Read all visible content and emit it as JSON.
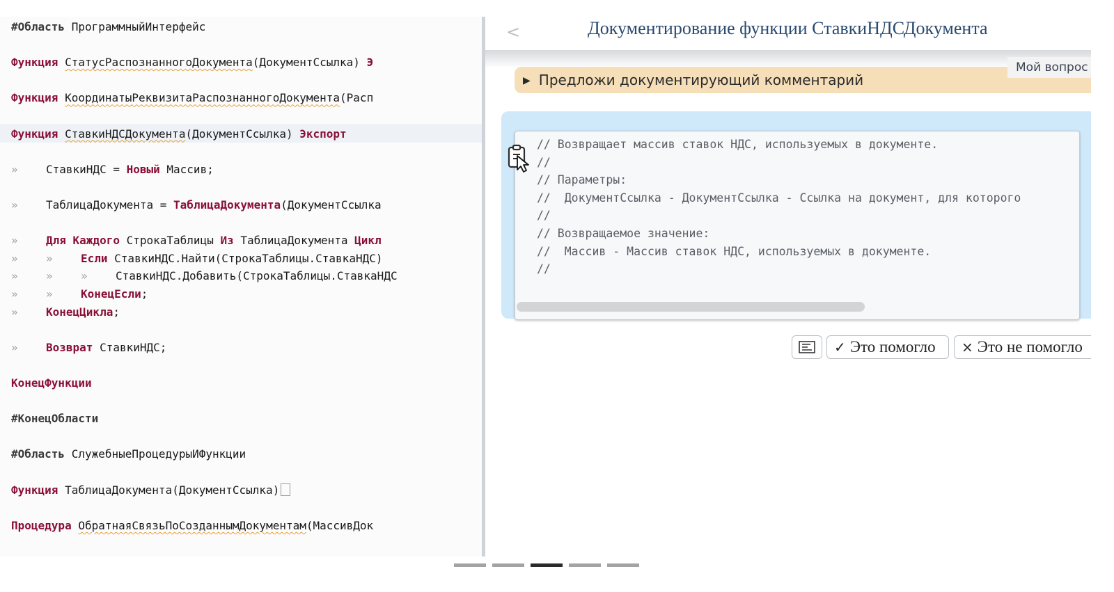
{
  "editor": {
    "lines": [
      [
        {
          "t": "#Область",
          "c": "dir"
        },
        {
          "t": " ПрограммныйИнтерфейс",
          "c": "id"
        }
      ],
      [],
      [
        {
          "t": "Функция",
          "c": "kw"
        },
        {
          "t": " ",
          "c": "id"
        },
        {
          "t": "СтатусРаспознанногоДокумента",
          "c": "id wavy"
        },
        {
          "t": "(ДокументСсылка) ",
          "c": "id"
        },
        {
          "t": "Э",
          "c": "kw"
        }
      ],
      [],
      [
        {
          "t": "Функция",
          "c": "kw"
        },
        {
          "t": " ",
          "c": "id"
        },
        {
          "t": "КоординатыРеквизитаРаспознанногоДокумента",
          "c": "id wavy"
        },
        {
          "t": "(Расп",
          "c": "id"
        }
      ],
      [],
      [
        {
          "t": "Функция",
          "c": "kw"
        },
        {
          "t": " ",
          "c": "id"
        },
        {
          "t": "СтавкиНДСДокумента",
          "c": "id wavy"
        },
        {
          "t": "(ДокументСсылка) ",
          "c": "id"
        },
        {
          "t": "Экспорт",
          "c": "kw"
        }
      ],
      [],
      [
        {
          "i": 1
        },
        {
          "t": "СтавкиНДС = ",
          "c": "id"
        },
        {
          "t": "Новый",
          "c": "kw"
        },
        {
          "t": " Массив;",
          "c": "id"
        }
      ],
      [],
      [
        {
          "i": 1
        },
        {
          "t": "ТаблицаДокумента = ",
          "c": "id"
        },
        {
          "t": "ТаблицаДокумента",
          "c": "kw"
        },
        {
          "t": "(ДокументСсылка",
          "c": "id"
        }
      ],
      [],
      [
        {
          "i": 1
        },
        {
          "t": "Для Каждого",
          "c": "kw"
        },
        {
          "t": " СтрокаТаблицы ",
          "c": "id"
        },
        {
          "t": "Из",
          "c": "kw"
        },
        {
          "t": " ТаблицаДокумента ",
          "c": "id"
        },
        {
          "t": "Цикл",
          "c": "kw"
        }
      ],
      [
        {
          "i": 2
        },
        {
          "t": "Если",
          "c": "kw"
        },
        {
          "t": " СтавкиНДС.Найти(СтрокаТаблицы.СтавкаНДС) ",
          "c": "id"
        }
      ],
      [
        {
          "i": 3
        },
        {
          "t": "СтавкиНДС.Добавить(СтрокаТаблицы.СтавкаНДС",
          "c": "id"
        }
      ],
      [
        {
          "i": 2
        },
        {
          "t": "КонецЕсли",
          "c": "kw"
        },
        {
          "t": ";",
          "c": "id"
        }
      ],
      [
        {
          "i": 1
        },
        {
          "t": "КонецЦикла",
          "c": "kw"
        },
        {
          "t": ";",
          "c": "id"
        }
      ],
      [],
      [
        {
          "i": 1
        },
        {
          "t": "Возврат",
          "c": "kw"
        },
        {
          "t": " СтавкиНДС;",
          "c": "id"
        }
      ],
      [],
      [
        {
          "t": "КонецФункции",
          "c": "kw"
        }
      ],
      [],
      [
        {
          "t": "#КонецОбласти",
          "c": "dir"
        }
      ],
      [],
      [
        {
          "t": "#Область",
          "c": "dir"
        },
        {
          "t": " СлужебныеПроцедурыИФункции",
          "c": "id"
        }
      ],
      [],
      [
        {
          "t": "Функция",
          "c": "kw"
        },
        {
          "t": " ТаблицаДокумента(ДокументСсылка)",
          "c": "id"
        },
        {
          "box": true
        }
      ],
      [],
      [
        {
          "t": "Процедура",
          "c": "kw"
        },
        {
          "t": " ",
          "c": "id"
        },
        {
          "t": "ОбратнаяСвязьПоСозданнымДокументам",
          "c": "id wavy"
        },
        {
          "t": "(МассивДок",
          "c": "id"
        }
      ]
    ],
    "indent_marker": "»"
  },
  "panel": {
    "back_glyph": "<",
    "title": "Документирование функции СтавкиНДСДокумента",
    "my_question_tab": "Мой вопрос",
    "suggestion": "Предложи документирующий комментарий",
    "suggestion_arrow": "▶",
    "code_lines": [
      "// Возвращает массив ставок НДС, используемых в документе.",
      "//",
      "// Параметры:",
      "//  ДокументСсылка - ДокументСсылка - Ссылка на документ, для которого",
      "//",
      "// Возвращаемое значение:",
      "//  Массив - Массив ставок НДС, используемых в документе.",
      "//"
    ],
    "buttons": {
      "helped_mark": "✓",
      "helped": "Это помогло",
      "not_helped_mark": "×",
      "not_helped": "Это не помогло"
    }
  },
  "pager": {
    "count": 5,
    "active": 3
  },
  "colors": {
    "keyword": "#8a1036",
    "suggestion_bg": "#f6dfb8",
    "bubble_bg": "#cfe9fb",
    "title": "#2a4a70"
  }
}
